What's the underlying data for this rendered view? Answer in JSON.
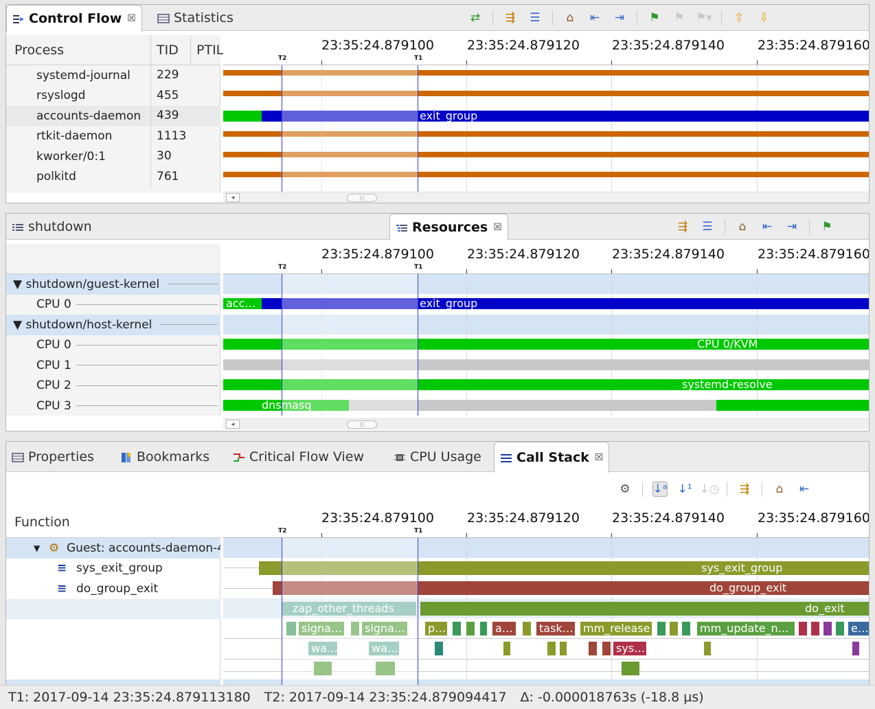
{
  "top_view": {
    "tabs": [
      {
        "label": "Control Flow",
        "close": "☒"
      },
      {
        "label": "Statistics"
      }
    ],
    "columns": {
      "process": "Process",
      "tid": "TID",
      "ptid": "PTIL"
    },
    "rows": [
      {
        "name": "systemd-journal",
        "tid": "229"
      },
      {
        "name": "rsyslogd",
        "tid": "455"
      },
      {
        "name": "accounts-daemon",
        "tid": "439"
      },
      {
        "name": "rtkit-daemon",
        "tid": "1113"
      },
      {
        "name": "kworker/0:1",
        "tid": "30"
      },
      {
        "name": "polkitd",
        "tid": "761"
      }
    ],
    "exit_label": "exit_group"
  },
  "time_axis": {
    "labels": [
      "23:35:24.879100",
      "23:35:24.879120",
      "23:35:24.879140",
      "23:35:24.879160"
    ],
    "marker_t2": "T2",
    "marker_t1": "T1"
  },
  "middle_view": {
    "tabs": [
      {
        "label": "shutdown"
      },
      {
        "label": "Resources",
        "close": "☒"
      }
    ],
    "rows": [
      {
        "label": "▼ shutdown/guest-kernel",
        "group": true
      },
      {
        "label": "CPU 0",
        "group": false
      },
      {
        "label": "▼ shutdown/host-kernel",
        "group": true
      },
      {
        "label": "CPU 0",
        "group": false
      },
      {
        "label": "CPU 1",
        "group": false
      },
      {
        "label": "CPU 2",
        "group": false
      },
      {
        "label": "CPU 3",
        "group": false
      }
    ],
    "bar_labels": {
      "acc": "acc…",
      "exit": "exit_group",
      "kvm": "CPU 0/KVM",
      "resolve": "systemd-resolve",
      "dnsmasq": "dnsmasq"
    }
  },
  "bottom_view": {
    "tabs": [
      {
        "label": "Properties"
      },
      {
        "label": "Bookmarks"
      },
      {
        "label": "Critical Flow View"
      },
      {
        "label": "CPU Usage"
      },
      {
        "label": "Call Stack",
        "close": "☒"
      }
    ],
    "column": "Function",
    "tree": [
      {
        "label": "Guest: accounts-daemon-4",
        "type": "guest"
      },
      {
        "label": "sys_exit_group",
        "type": "function"
      },
      {
        "label": "do_group_exit",
        "type": "function"
      }
    ],
    "bar_labels": {
      "sys_exit_group": "sys_exit_group",
      "do_group_exit": "do_group_exit",
      "zap": "zap_other_threads",
      "do_exit": "do_exit",
      "signa1": "signa…",
      "signa2": "signa…",
      "p": "p…",
      "a": "a…",
      "task": "task…",
      "mm_release": "mm_release",
      "mm_update": "mm_update_n…",
      "e": "e…",
      "wa1": "wa…",
      "wa2": "wa…",
      "sys": "sys…"
    }
  },
  "status_bar": {
    "t1": "T1: 2017-09-14 23:35:24.879113180",
    "t2": "T2: 2017-09-14 23:35:24.879094417",
    "delta": "Δ: -0.000018763s (-18.8 µs)"
  },
  "colors": {
    "orange": "#cc6600",
    "orange_light": "#e0a266",
    "blue": "#0000c8",
    "blue_light": "#6666dd",
    "green": "#00c800",
    "green_light": "#66dd66",
    "gray": "#c8c8c8",
    "olive": "#8b9a2a",
    "brown": "#a0453a",
    "teal": "#6fb2a0",
    "olive_green": "#6a9a30",
    "selection": "#3b3bd8"
  }
}
